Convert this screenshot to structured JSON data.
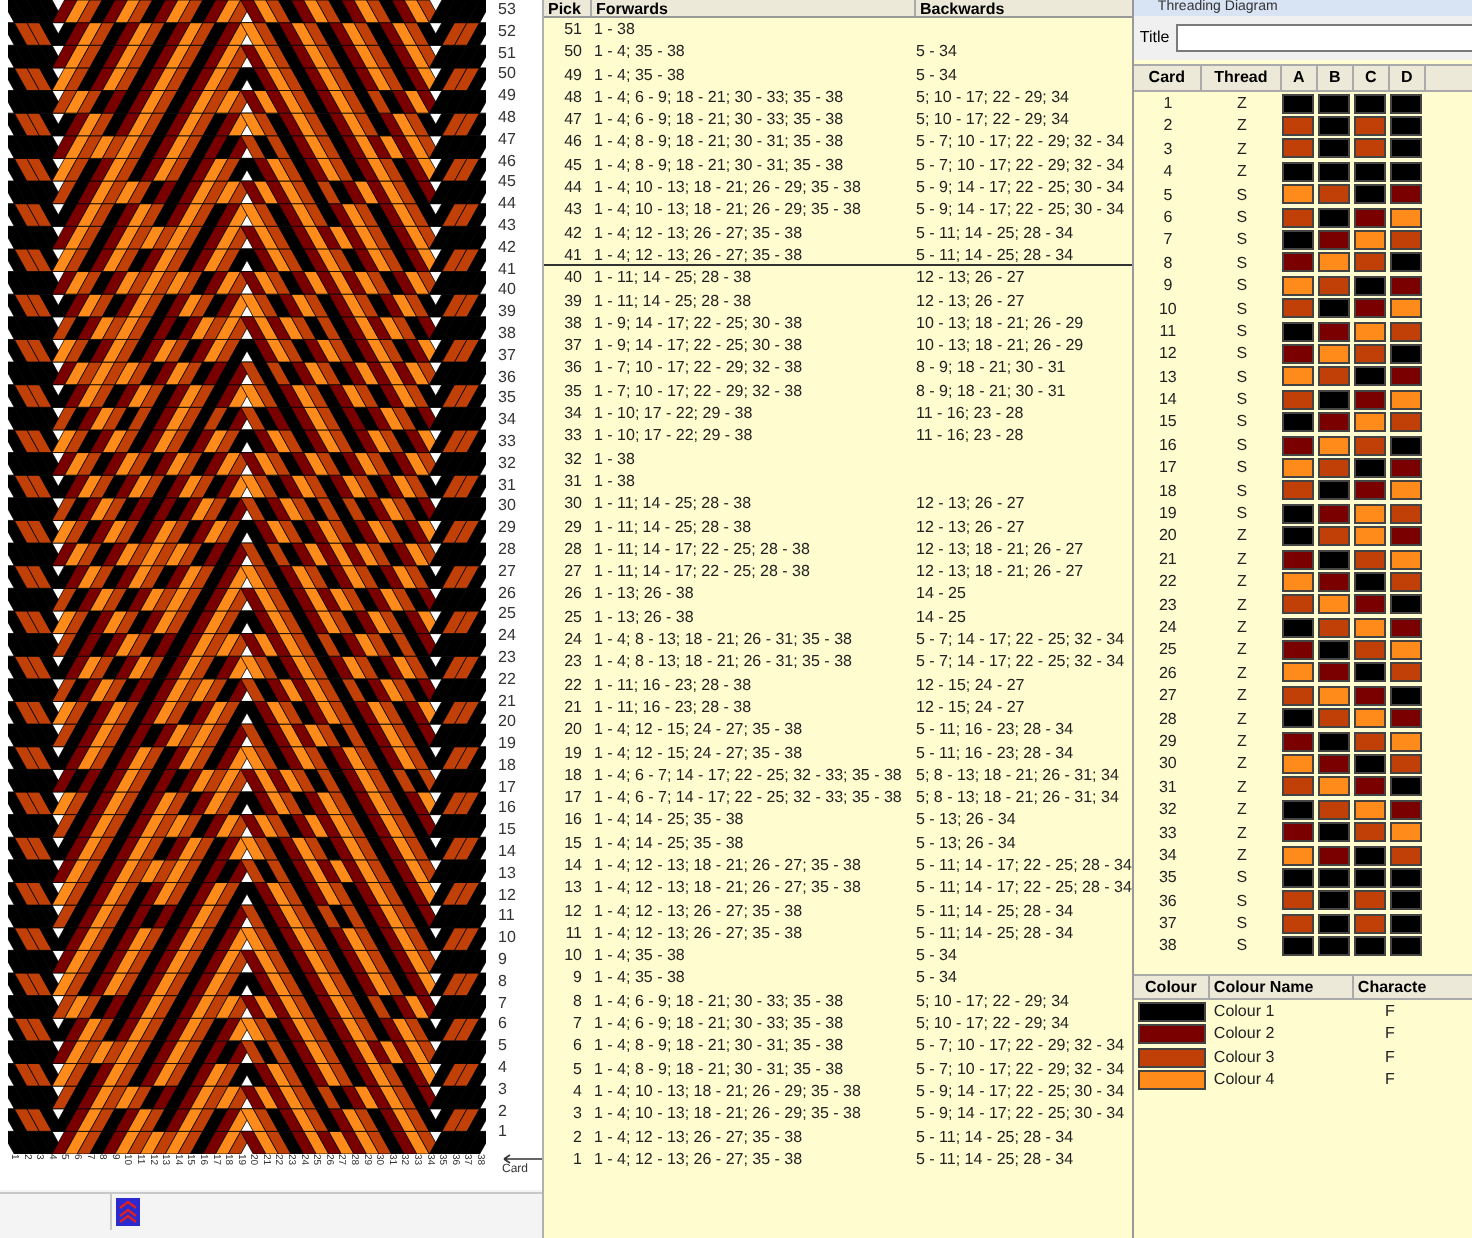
{
  "pattern_panel": {
    "row_numbers": [
      "53",
      "52",
      "51",
      "50",
      "49",
      "48",
      "47",
      "46",
      "45",
      "44",
      "43",
      "42",
      "41",
      "40",
      "39",
      "38",
      "37",
      "36",
      "35",
      "34",
      "33",
      "32",
      "31",
      "30",
      "29",
      "28",
      "27",
      "26",
      "25",
      "24",
      "23",
      "22",
      "21",
      "20",
      "19",
      "18",
      "17",
      "16",
      "15",
      "14",
      "13",
      "12",
      "11",
      "10",
      "9",
      "8",
      "7",
      "6",
      "5",
      "4",
      "3",
      "2",
      "1"
    ],
    "card_numbers": [
      "1",
      "2",
      "3",
      "4",
      "5",
      "6",
      "7",
      "8",
      "9",
      "10",
      "11",
      "12",
      "13",
      "14",
      "15",
      "16",
      "17",
      "18",
      "19",
      "20",
      "21",
      "22",
      "23",
      "24",
      "25",
      "26",
      "27",
      "28",
      "29",
      "30",
      "31",
      "32",
      "33",
      "34",
      "35",
      "36",
      "37",
      "38"
    ],
    "card_axis_label": "Card"
  },
  "pick_table": {
    "columns": [
      "Pick",
      "Forwards",
      "Backwards"
    ],
    "rows": [
      {
        "pick": "51",
        "forwards": "1 - 38",
        "divider_below": false
      },
      {
        "pick": "50",
        "forwards": "1 - 4; 35 - 38",
        "backwards": "5 - 34",
        "divider_below": false
      },
      {
        "pick": "49",
        "forwards": "1 - 4; 35 - 38",
        "backwards": "5 - 34",
        "divider_below": false
      },
      {
        "pick": "48",
        "forwards": "1 - 4; 6 - 9; 18 - 21; 30 - 33; 35 - 38",
        "backwards": "5; 10 - 17; 22 - 29; 34",
        "divider_below": false
      },
      {
        "pick": "47",
        "forwards": "1 - 4; 6 - 9; 18 - 21; 30 - 33; 35 - 38",
        "backwards": "5; 10 - 17; 22 - 29; 34",
        "divider_below": false
      },
      {
        "pick": "46",
        "forwards": "1 - 4; 8 - 9; 18 - 21; 30 - 31; 35 - 38",
        "backwards": "5 - 7; 10 - 17; 22 - 29; 32 - 34",
        "divider_below": false
      },
      {
        "pick": "45",
        "forwards": "1 - 4; 8 - 9; 18 - 21; 30 - 31; 35 - 38",
        "backwards": "5 - 7; 10 - 17; 22 - 29; 32 - 34",
        "divider_below": false
      },
      {
        "pick": "44",
        "forwards": "1 - 4; 10 - 13; 18 - 21; 26 - 29; 35 - 38",
        "backwards": "5 - 9; 14 - 17; 22 - 25; 30 - 34",
        "divider_below": false
      },
      {
        "pick": "43",
        "forwards": "1 - 4; 10 - 13; 18 - 21; 26 - 29; 35 - 38",
        "backwards": "5 - 9; 14 - 17; 22 - 25; 30 - 34",
        "divider_below": false
      },
      {
        "pick": "42",
        "forwards": "1 - 4; 12 - 13; 26 - 27; 35 - 38",
        "backwards": "5 - 11; 14 - 25; 28 - 34",
        "divider_below": false
      },
      {
        "pick": "41",
        "forwards": "1 - 4; 12 - 13; 26 - 27; 35 - 38",
        "backwards": "5 - 11; 14 - 25; 28 - 34",
        "divider_below": true
      },
      {
        "pick": "40",
        "forwards": "1 - 11; 14 - 25; 28 - 38",
        "backwards": "12 - 13; 26 - 27",
        "divider_below": false
      },
      {
        "pick": "39",
        "forwards": "1 - 11; 14 - 25; 28 - 38",
        "backwards": "12 - 13; 26 - 27",
        "divider_below": false
      },
      {
        "pick": "38",
        "forwards": "1 - 9; 14 - 17; 22 - 25; 30 - 38",
        "backwards": "10 - 13; 18 - 21; 26 - 29",
        "divider_below": false
      },
      {
        "pick": "37",
        "forwards": "1 - 9; 14 - 17; 22 - 25; 30 - 38",
        "backwards": "10 - 13; 18 - 21; 26 - 29",
        "divider_below": false
      },
      {
        "pick": "36",
        "forwards": "1 - 7; 10 - 17; 22 - 29; 32 - 38",
        "backwards": "8 - 9; 18 - 21; 30 - 31",
        "divider_below": false
      },
      {
        "pick": "35",
        "forwards": "1 - 7; 10 - 17; 22 - 29; 32 - 38",
        "backwards": "8 - 9; 18 - 21; 30 - 31",
        "divider_below": false
      },
      {
        "pick": "34",
        "forwards": "1 - 10; 17 - 22; 29 - 38",
        "backwards": "11 - 16; 23 - 28",
        "divider_below": false
      },
      {
        "pick": "33",
        "forwards": "1 - 10; 17 - 22; 29 - 38",
        "backwards": "11 - 16; 23 - 28",
        "divider_below": false
      },
      {
        "pick": "32",
        "forwards": "1 - 38",
        "divider_below": false
      },
      {
        "pick": "31",
        "forwards": "1 - 38",
        "divider_below": false
      },
      {
        "pick": "30",
        "forwards": "1 - 11; 14 - 25; 28 - 38",
        "backwards": "12 - 13; 26 - 27",
        "divider_below": false
      },
      {
        "pick": "29",
        "forwards": "1 - 11; 14 - 25; 28 - 38",
        "backwards": "12 - 13; 26 - 27",
        "divider_below": false
      },
      {
        "pick": "28",
        "forwards": "1 - 11; 14 - 17; 22 - 25; 28 - 38",
        "backwards": "12 - 13; 18 - 21; 26 - 27",
        "divider_below": false
      },
      {
        "pick": "27",
        "forwards": "1 - 11; 14 - 17; 22 - 25; 28 - 38",
        "backwards": "12 - 13; 18 - 21; 26 - 27",
        "divider_below": false
      },
      {
        "pick": "26",
        "forwards": "1 - 13; 26 - 38",
        "backwards": "14 - 25",
        "divider_below": false
      },
      {
        "pick": "25",
        "forwards": "1 - 13; 26 - 38",
        "backwards": "14 - 25",
        "divider_below": false
      },
      {
        "pick": "24",
        "forwards": "1 - 4; 8 - 13; 18 - 21; 26 - 31; 35 - 38",
        "backwards": "5 - 7; 14 - 17; 22 - 25; 32 - 34",
        "divider_below": false
      },
      {
        "pick": "23",
        "forwards": "1 - 4; 8 - 13; 18 - 21; 26 - 31; 35 - 38",
        "backwards": "5 - 7; 14 - 17; 22 - 25; 32 - 34",
        "divider_below": false
      },
      {
        "pick": "22",
        "forwards": "1 - 11; 16 - 23; 28 - 38",
        "backwards": "12 - 15; 24 - 27",
        "divider_below": false
      },
      {
        "pick": "21",
        "forwards": "1 - 11; 16 - 23; 28 - 38",
        "backwards": "12 - 15; 24 - 27",
        "divider_below": false
      },
      {
        "pick": "20",
        "forwards": "1 - 4; 12 - 15; 24 - 27; 35 - 38",
        "backwards": "5 - 11; 16 - 23; 28 - 34",
        "divider_below": false
      },
      {
        "pick": "19",
        "forwards": "1 - 4; 12 - 15; 24 - 27; 35 - 38",
        "backwards": "5 - 11; 16 - 23; 28 - 34",
        "divider_below": false
      },
      {
        "pick": "18",
        "forwards": "1 - 4; 6 - 7; 14 - 17; 22 - 25; 32 - 33; 35 - 38",
        "backwards": "5; 8 - 13; 18 - 21; 26 - 31; 34",
        "divider_below": false
      },
      {
        "pick": "17",
        "forwards": "1 - 4; 6 - 7; 14 - 17; 22 - 25; 32 - 33; 35 - 38",
        "backwards": "5; 8 - 13; 18 - 21; 26 - 31; 34",
        "divider_below": false
      },
      {
        "pick": "16",
        "forwards": "1 - 4; 14 - 25; 35 - 38",
        "backwards": "5 - 13; 26 - 34",
        "divider_below": false
      },
      {
        "pick": "15",
        "forwards": "1 - 4; 14 - 25; 35 - 38",
        "backwards": "5 - 13; 26 - 34",
        "divider_below": false
      },
      {
        "pick": "14",
        "forwards": "1 - 4; 12 - 13; 18 - 21; 26 - 27; 35 - 38",
        "backwards": "5 - 11; 14 - 17; 22 - 25; 28 - 34",
        "divider_below": false
      },
      {
        "pick": "13",
        "forwards": "1 - 4; 12 - 13; 18 - 21; 26 - 27; 35 - 38",
        "backwards": "5 - 11; 14 - 17; 22 - 25; 28 - 34",
        "divider_below": false
      },
      {
        "pick": "12",
        "forwards": "1 - 4; 12 - 13; 26 - 27; 35 - 38",
        "backwards": "5 - 11; 14 - 25; 28 - 34",
        "divider_below": false
      },
      {
        "pick": "11",
        "forwards": "1 - 4; 12 - 13; 26 - 27; 35 - 38",
        "backwards": "5 - 11; 14 - 25; 28 - 34",
        "divider_below": false
      },
      {
        "pick": "10",
        "forwards": "1 - 4; 35 - 38",
        "backwards": "5 - 34",
        "divider_below": false
      },
      {
        "pick": "9",
        "forwards": "1 - 4; 35 - 38",
        "backwards": "5 - 34",
        "divider_below": false
      },
      {
        "pick": "8",
        "forwards": "1 - 4; 6 - 9; 18 - 21; 30 - 33; 35 - 38",
        "backwards": "5; 10 - 17; 22 - 29; 34",
        "divider_below": false
      },
      {
        "pick": "7",
        "forwards": "1 - 4; 6 - 9; 18 - 21; 30 - 33; 35 - 38",
        "backwards": "5; 10 - 17; 22 - 29; 34",
        "divider_below": false
      },
      {
        "pick": "6",
        "forwards": "1 - 4; 8 - 9; 18 - 21; 30 - 31; 35 - 38",
        "backwards": "5 - 7; 10 - 17; 22 - 29; 32 - 34",
        "divider_below": false
      },
      {
        "pick": "5",
        "forwards": "1 - 4; 8 - 9; 18 - 21; 30 - 31; 35 - 38",
        "backwards": "5 - 7; 10 - 17; 22 - 29; 32 - 34",
        "divider_below": false
      },
      {
        "pick": "4",
        "forwards": "1 - 4; 10 - 13; 18 - 21; 26 - 29; 35 - 38",
        "backwards": "5 - 9; 14 - 17; 22 - 25; 30 - 34",
        "divider_below": false
      },
      {
        "pick": "3",
        "forwards": "1 - 4; 10 - 13; 18 - 21; 26 - 29; 35 - 38",
        "backwards": "5 - 9; 14 - 17; 22 - 25; 30 - 34",
        "divider_below": false
      },
      {
        "pick": "2",
        "forwards": "1 - 4; 12 - 13; 26 - 27; 35 - 38",
        "backwards": "5 - 11; 14 - 25; 28 - 34",
        "divider_below": false
      },
      {
        "pick": "1",
        "forwards": "1 - 4; 12 - 13; 26 - 27; 35 - 38",
        "backwards": "5 - 11; 14 - 25; 28 - 34",
        "divider_below": false
      }
    ]
  },
  "threading": {
    "window_title": "Threading Diagram",
    "title_label": "Title",
    "columns": [
      "Card",
      "Thread",
      "A",
      "B",
      "C",
      "D"
    ],
    "cards": [
      {
        "card": "1",
        "thread": "Z",
        "holes": [
          {
            "color": "#000000"
          },
          {
            "color": "#000000"
          },
          {
            "color": "#000000"
          },
          {
            "color": "#000000"
          }
        ]
      },
      {
        "card": "2",
        "thread": "Z",
        "holes": [
          {
            "color": "#c04008"
          },
          {
            "color": "#000000"
          },
          {
            "color": "#c04008"
          },
          {
            "color": "#000000"
          }
        ]
      },
      {
        "card": "3",
        "thread": "Z",
        "holes": [
          {
            "color": "#c04008"
          },
          {
            "color": "#000000"
          },
          {
            "color": "#c04008"
          },
          {
            "color": "#000000"
          }
        ]
      },
      {
        "card": "4",
        "thread": "Z",
        "holes": [
          {
            "color": "#000000"
          },
          {
            "color": "#000000"
          },
          {
            "color": "#000000"
          },
          {
            "color": "#000000"
          }
        ]
      },
      {
        "card": "5",
        "thread": "S",
        "holes": [
          {
            "color": "#ff8c1a"
          },
          {
            "color": "#c04008"
          },
          {
            "color": "#000000"
          },
          {
            "color": "#7a0000"
          }
        ]
      },
      {
        "card": "6",
        "thread": "S",
        "holes": [
          {
            "color": "#c04008"
          },
          {
            "color": "#000000"
          },
          {
            "color": "#7a0000"
          },
          {
            "color": "#ff8c1a"
          }
        ]
      },
      {
        "card": "7",
        "thread": "S",
        "holes": [
          {
            "color": "#000000"
          },
          {
            "color": "#7a0000"
          },
          {
            "color": "#ff8c1a"
          },
          {
            "color": "#c04008"
          }
        ]
      },
      {
        "card": "8",
        "thread": "S",
        "holes": [
          {
            "color": "#7a0000"
          },
          {
            "color": "#ff8c1a"
          },
          {
            "color": "#c04008"
          },
          {
            "color": "#000000"
          }
        ]
      },
      {
        "card": "9",
        "thread": "S",
        "holes": [
          {
            "color": "#ff8c1a"
          },
          {
            "color": "#c04008"
          },
          {
            "color": "#000000"
          },
          {
            "color": "#7a0000"
          }
        ]
      },
      {
        "card": "10",
        "thread": "S",
        "holes": [
          {
            "color": "#c04008"
          },
          {
            "color": "#000000"
          },
          {
            "color": "#7a0000"
          },
          {
            "color": "#ff8c1a"
          }
        ]
      },
      {
        "card": "11",
        "thread": "S",
        "holes": [
          {
            "color": "#000000"
          },
          {
            "color": "#7a0000"
          },
          {
            "color": "#ff8c1a"
          },
          {
            "color": "#c04008"
          }
        ]
      },
      {
        "card": "12",
        "thread": "S",
        "holes": [
          {
            "color": "#7a0000"
          },
          {
            "color": "#ff8c1a"
          },
          {
            "color": "#c04008"
          },
          {
            "color": "#000000"
          }
        ]
      },
      {
        "card": "13",
        "thread": "S",
        "holes": [
          {
            "color": "#ff8c1a"
          },
          {
            "color": "#c04008"
          },
          {
            "color": "#000000"
          },
          {
            "color": "#7a0000"
          }
        ]
      },
      {
        "card": "14",
        "thread": "S",
        "holes": [
          {
            "color": "#c04008"
          },
          {
            "color": "#000000"
          },
          {
            "color": "#7a0000"
          },
          {
            "color": "#ff8c1a"
          }
        ]
      },
      {
        "card": "15",
        "thread": "S",
        "holes": [
          {
            "color": "#000000"
          },
          {
            "color": "#7a0000"
          },
          {
            "color": "#ff8c1a"
          },
          {
            "color": "#c04008"
          }
        ]
      },
      {
        "card": "16",
        "thread": "S",
        "holes": [
          {
            "color": "#7a0000"
          },
          {
            "color": "#ff8c1a"
          },
          {
            "color": "#c04008"
          },
          {
            "color": "#000000"
          }
        ]
      },
      {
        "card": "17",
        "thread": "S",
        "holes": [
          {
            "color": "#ff8c1a"
          },
          {
            "color": "#c04008"
          },
          {
            "color": "#000000"
          },
          {
            "color": "#7a0000"
          }
        ]
      },
      {
        "card": "18",
        "thread": "S",
        "holes": [
          {
            "color": "#c04008"
          },
          {
            "color": "#000000"
          },
          {
            "color": "#7a0000"
          },
          {
            "color": "#ff8c1a"
          }
        ]
      },
      {
        "card": "19",
        "thread": "S",
        "holes": [
          {
            "color": "#000000"
          },
          {
            "color": "#7a0000"
          },
          {
            "color": "#ff8c1a"
          },
          {
            "color": "#c04008"
          }
        ]
      },
      {
        "card": "20",
        "thread": "Z",
        "holes": [
          {
            "color": "#000000"
          },
          {
            "color": "#c04008"
          },
          {
            "color": "#ff8c1a"
          },
          {
            "color": "#7a0000"
          }
        ]
      },
      {
        "card": "21",
        "thread": "Z",
        "holes": [
          {
            "color": "#7a0000"
          },
          {
            "color": "#000000"
          },
          {
            "color": "#c04008"
          },
          {
            "color": "#ff8c1a"
          }
        ]
      },
      {
        "card": "22",
        "thread": "Z",
        "holes": [
          {
            "color": "#ff8c1a"
          },
          {
            "color": "#7a0000"
          },
          {
            "color": "#000000"
          },
          {
            "color": "#c04008"
          }
        ]
      },
      {
        "card": "23",
        "thread": "Z",
        "holes": [
          {
            "color": "#c04008"
          },
          {
            "color": "#ff8c1a"
          },
          {
            "color": "#7a0000"
          },
          {
            "color": "#000000"
          }
        ]
      },
      {
        "card": "24",
        "thread": "Z",
        "holes": [
          {
            "color": "#000000"
          },
          {
            "color": "#c04008"
          },
          {
            "color": "#ff8c1a"
          },
          {
            "color": "#7a0000"
          }
        ]
      },
      {
        "card": "25",
        "thread": "Z",
        "holes": [
          {
            "color": "#7a0000"
          },
          {
            "color": "#000000"
          },
          {
            "color": "#c04008"
          },
          {
            "color": "#ff8c1a"
          }
        ]
      },
      {
        "card": "26",
        "thread": "Z",
        "holes": [
          {
            "color": "#ff8c1a"
          },
          {
            "color": "#7a0000"
          },
          {
            "color": "#000000"
          },
          {
            "color": "#c04008"
          }
        ]
      },
      {
        "card": "27",
        "thread": "Z",
        "holes": [
          {
            "color": "#c04008"
          },
          {
            "color": "#ff8c1a"
          },
          {
            "color": "#7a0000"
          },
          {
            "color": "#000000"
          }
        ]
      },
      {
        "card": "28",
        "thread": "Z",
        "holes": [
          {
            "color": "#000000"
          },
          {
            "color": "#c04008"
          },
          {
            "color": "#ff8c1a"
          },
          {
            "color": "#7a0000"
          }
        ]
      },
      {
        "card": "29",
        "thread": "Z",
        "holes": [
          {
            "color": "#7a0000"
          },
          {
            "color": "#000000"
          },
          {
            "color": "#c04008"
          },
          {
            "color": "#ff8c1a"
          }
        ]
      },
      {
        "card": "30",
        "thread": "Z",
        "holes": [
          {
            "color": "#ff8c1a"
          },
          {
            "color": "#7a0000"
          },
          {
            "color": "#000000"
          },
          {
            "color": "#c04008"
          }
        ]
      },
      {
        "card": "31",
        "thread": "Z",
        "holes": [
          {
            "color": "#c04008"
          },
          {
            "color": "#ff8c1a"
          },
          {
            "color": "#7a0000"
          },
          {
            "color": "#000000"
          }
        ]
      },
      {
        "card": "32",
        "thread": "Z",
        "holes": [
          {
            "color": "#000000"
          },
          {
            "color": "#c04008"
          },
          {
            "color": "#ff8c1a"
          },
          {
            "color": "#7a0000"
          }
        ]
      },
      {
        "card": "33",
        "thread": "Z",
        "holes": [
          {
            "color": "#7a0000"
          },
          {
            "color": "#000000"
          },
          {
            "color": "#c04008"
          },
          {
            "color": "#ff8c1a"
          }
        ]
      },
      {
        "card": "34",
        "thread": "Z",
        "holes": [
          {
            "color": "#ff8c1a"
          },
          {
            "color": "#7a0000"
          },
          {
            "color": "#000000"
          },
          {
            "color": "#c04008"
          }
        ]
      },
      {
        "card": "35",
        "thread": "S",
        "holes": [
          {
            "color": "#000000"
          },
          {
            "color": "#000000"
          },
          {
            "color": "#000000"
          },
          {
            "color": "#000000"
          }
        ]
      },
      {
        "card": "36",
        "thread": "S",
        "holes": [
          {
            "color": "#c04008"
          },
          {
            "color": "#000000"
          },
          {
            "color": "#c04008"
          },
          {
            "color": "#000000"
          }
        ]
      },
      {
        "card": "37",
        "thread": "S",
        "holes": [
          {
            "color": "#c04008"
          },
          {
            "color": "#000000"
          },
          {
            "color": "#c04008"
          },
          {
            "color": "#000000"
          }
        ]
      },
      {
        "card": "38",
        "thread": "S",
        "holes": [
          {
            "color": "#000000"
          },
          {
            "color": "#000000"
          },
          {
            "color": "#000000"
          },
          {
            "color": "#000000"
          }
        ]
      }
    ]
  },
  "colour_table": {
    "columns": [
      "Colour",
      "Colour Name",
      "Characte"
    ],
    "rows": [
      {
        "color": "#000000",
        "name": "Colour 1",
        "character": "F"
      },
      {
        "color": "#7a0000",
        "name": "Colour 2",
        "character": "F"
      },
      {
        "color": "#c04008",
        "name": "Colour 3",
        "character": "F"
      },
      {
        "color": "#ff8c1a",
        "name": "Colour 4",
        "character": "F"
      }
    ]
  }
}
